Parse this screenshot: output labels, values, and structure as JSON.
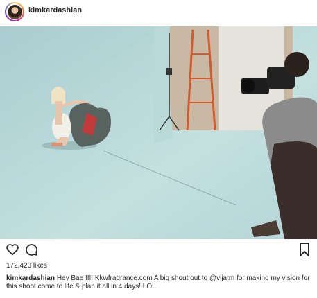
{
  "post": {
    "username": "kimkardashian",
    "likes": "172,423 likes",
    "caption_user": "kimkardashian",
    "caption_text": " Hey Bae !!!! Kkwfragrance.com A big shout out to @vijatm for making my vision for this shoot come to life & plan it all in 4 days! LOL"
  },
  "icons": {
    "like": "heart-icon",
    "comment": "comment-icon",
    "save": "bookmark-icon"
  },
  "colors": {
    "text": "#262626",
    "backdrop": "#bcdcdc",
    "ring_gradient": [
      "#feda75",
      "#fa7e1e",
      "#d62976",
      "#962fbf",
      "#4f5bd5"
    ]
  }
}
